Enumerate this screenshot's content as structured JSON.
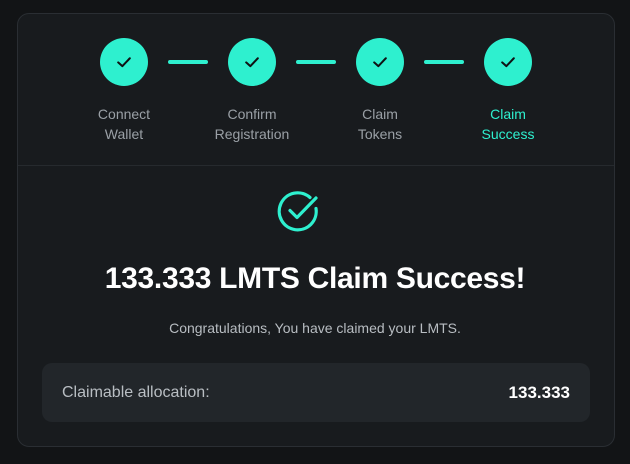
{
  "colors": {
    "accent": "#2ef0cf",
    "card_bg": "#181b1e",
    "page_bg": "#121416",
    "text_muted": "#9aa0a6"
  },
  "stepper": {
    "steps": [
      {
        "line1": "Connect",
        "line2": "Wallet",
        "state": "completed",
        "icon": "check-icon"
      },
      {
        "line1": "Confirm",
        "line2": "Registration",
        "state": "completed",
        "icon": "check-icon"
      },
      {
        "line1": "Claim",
        "line2": "Tokens",
        "state": "completed",
        "icon": "check-icon"
      },
      {
        "line1": "Claim",
        "line2": "Success",
        "state": "active",
        "icon": "check-icon"
      }
    ]
  },
  "result": {
    "icon": "check-circle-icon",
    "headline": "133.333 LMTS Claim Success!",
    "message": "Congratulations, You have claimed your LMTS."
  },
  "allocation": {
    "label": "Claimable allocation:",
    "value": "133.333"
  }
}
